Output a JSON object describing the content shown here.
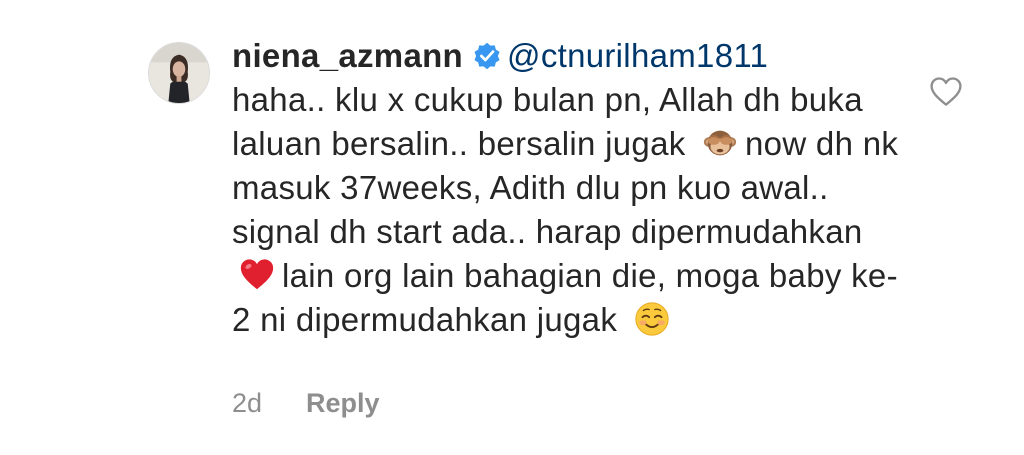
{
  "comment": {
    "username": "niena_azmann",
    "verified_icon": "verified-badge-icon",
    "mention": "@ctnurilham1811",
    "segments": [
      "haha.. klu x cukup bulan pn, Allah dh buka laluan bersalin.. bersalin jugak",
      "now dh nk masuk 37weeks, Adith dlu pn kuo awal.. signal dh start ada.. harap dipermudahkan",
      "lain org lain bahagian die, moga baby ke-2 ni dipermudahkan jugak"
    ],
    "emojis": [
      "see-no-evil-monkey-icon",
      "red-heart-icon",
      "smiling-face-icon"
    ],
    "timestamp": "2d",
    "reply_label": "Reply",
    "like_icon": "heart-outline-icon",
    "colors": {
      "text": "#262626",
      "mention": "#00376b",
      "muted": "#8e8e8e",
      "verified": "#3897f0",
      "heart": "#8e8e8e"
    }
  }
}
